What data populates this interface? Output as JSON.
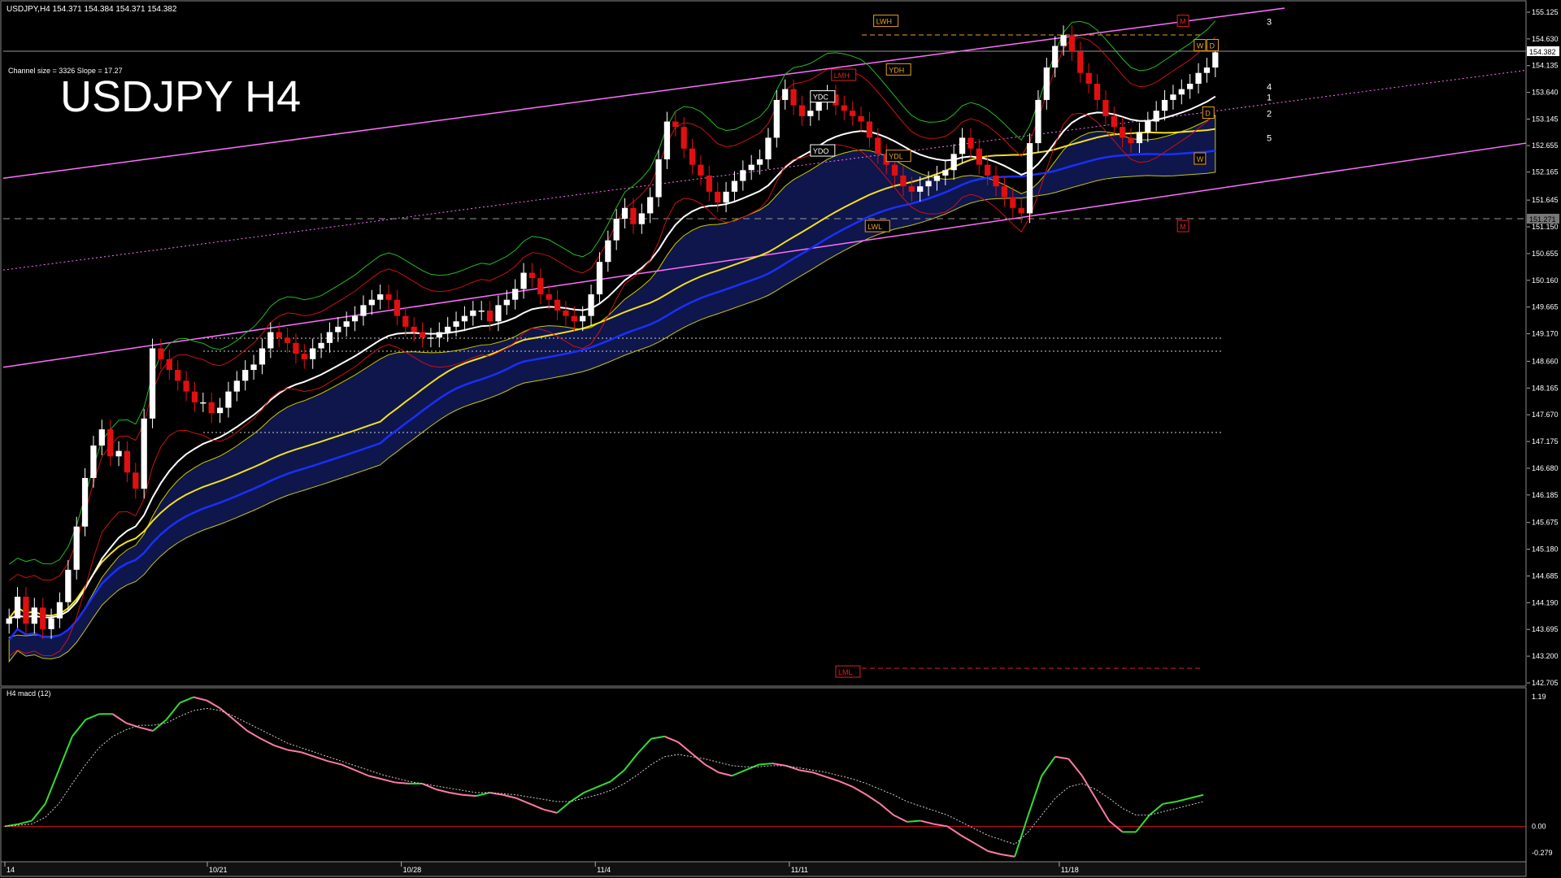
{
  "header": {
    "symbol_line": "USDJPY,H4  154.371 154.384 154.371 154.382",
    "channel_info": "Channel size = 3326 Slope = 17.27",
    "big_title": "USDJPY H4"
  },
  "macd_label": "H4  macd (12)",
  "current_price": "154.382",
  "h_line_price": "151.271",
  "colors": {
    "bg": "#000000",
    "grid": "#6e6e6e",
    "channel": "#ff6fff",
    "ema_white": "#ffffff",
    "ma_yellow": "#f2e01c",
    "ma_blue": "#1a2fff",
    "kumo": "#2a3ed8",
    "bull": "#ffffff",
    "bear": "#e01010",
    "macd_up": "#33dd33",
    "macd_down": "#ff7aa8",
    "signal": "#cccccc",
    "label_orange": "#e8a020",
    "label_red": "#e02020"
  },
  "chart_data": {
    "type": "line",
    "title": "USDJPY H4",
    "xlabel": "",
    "ylabel": "",
    "ylim": [
      142.705,
      155.2
    ],
    "grid": false,
    "y_ticks": [
      155.125,
      154.63,
      154.135,
      153.64,
      153.145,
      152.655,
      152.165,
      151.645,
      151.15,
      150.655,
      150.16,
      149.665,
      149.17,
      148.66,
      148.165,
      147.67,
      147.175,
      146.68,
      146.185,
      145.675,
      145.18,
      144.685,
      144.19,
      143.695,
      143.2,
      142.705
    ],
    "y_tick_labels": [
      "155.125",
      "154.630",
      "154.135",
      "153.640",
      "153.145",
      "152.655",
      "152.165",
      "151.645",
      "151.150",
      "150.655",
      "150.160",
      "149.665",
      "149.170",
      "148.660",
      "148.165",
      "147.670",
      "147.175",
      "146.680",
      "146.185",
      "145.675",
      "145.180",
      "144.685",
      "144.190",
      "143.695",
      "143.200",
      "142.705"
    ],
    "x_ticks": [
      {
        "i": 0,
        "label": "14"
      },
      {
        "i": 48,
        "label": "10/21"
      },
      {
        "i": 94,
        "label": "10/28"
      },
      {
        "i": 140,
        "label": "11/4"
      },
      {
        "i": 186,
        "label": "11/11"
      },
      {
        "i": 250,
        "label": "11/18"
      }
    ],
    "close": [
      143.9,
      144.3,
      143.8,
      144.1,
      143.7,
      143.9,
      144.2,
      144.8,
      145.6,
      146.5,
      147.1,
      147.4,
      146.9,
      147.0,
      146.6,
      146.3,
      147.6,
      148.9,
      148.7,
      148.5,
      148.3,
      148.1,
      147.9,
      147.9,
      147.7,
      147.8,
      148.1,
      148.3,
      148.5,
      148.6,
      148.9,
      149.2,
      149.1,
      149.0,
      148.8,
      148.7,
      148.9,
      149.0,
      149.2,
      149.3,
      149.4,
      149.5,
      149.7,
      149.8,
      149.9,
      149.8,
      149.5,
      149.3,
      149.2,
      149.1,
      149.1,
      149.2,
      149.3,
      149.4,
      149.5,
      149.6,
      149.6,
      149.4,
      149.7,
      149.8,
      150.0,
      150.3,
      150.2,
      149.9,
      149.8,
      149.6,
      149.5,
      149.4,
      149.5,
      149.9,
      150.5,
      150.9,
      151.3,
      151.5,
      151.2,
      151.4,
      151.7,
      152.4,
      153.1,
      153.0,
      152.6,
      152.3,
      152.1,
      151.8,
      151.6,
      151.8,
      152.0,
      152.2,
      152.3,
      152.4,
      152.8,
      153.5,
      153.7,
      153.4,
      153.2,
      153.3,
      153.5,
      153.6,
      153.4,
      153.3,
      153.2,
      153.1,
      152.8,
      152.5,
      152.3,
      152.1,
      151.9,
      151.8,
      151.9,
      152.0,
      152.1,
      152.2,
      152.5,
      152.8,
      152.6,
      152.3,
      152.1,
      151.9,
      151.7,
      151.5,
      151.4,
      152.7,
      153.5,
      154.1,
      154.5,
      154.7,
      154.4,
      154.0,
      153.8,
      153.5,
      153.2,
      153.0,
      152.8,
      152.7,
      152.9,
      153.1,
      153.3,
      153.5,
      153.6,
      153.7,
      153.8,
      154.0,
      154.1,
      154.382
    ],
    "series": [],
    "macd_ylim": [
      -0.279,
      1.19
    ],
    "macd_ticks": [
      "1.19",
      "0.00",
      "-0.279"
    ],
    "macd_main": [
      0.0,
      0.02,
      0.05,
      0.2,
      0.5,
      0.8,
      0.95,
      1.0,
      1.0,
      0.92,
      0.88,
      0.85,
      0.95,
      1.1,
      1.15,
      1.12,
      1.05,
      0.95,
      0.85,
      0.78,
      0.72,
      0.68,
      0.66,
      0.62,
      0.58,
      0.55,
      0.5,
      0.45,
      0.42,
      0.39,
      0.38,
      0.38,
      0.33,
      0.3,
      0.28,
      0.27,
      0.3,
      0.28,
      0.25,
      0.2,
      0.15,
      0.12,
      0.22,
      0.3,
      0.35,
      0.4,
      0.5,
      0.65,
      0.78,
      0.8,
      0.75,
      0.65,
      0.55,
      0.48,
      0.45,
      0.5,
      0.55,
      0.56,
      0.54,
      0.5,
      0.48,
      0.44,
      0.4,
      0.35,
      0.28,
      0.2,
      0.1,
      0.04,
      0.05,
      0.02,
      0.0,
      -0.08,
      -0.15,
      -0.22,
      -0.25,
      -0.27,
      0.1,
      0.45,
      0.62,
      0.6,
      0.45,
      0.25,
      0.05,
      -0.05,
      -0.05,
      0.1,
      0.2,
      0.22,
      0.25,
      0.28
    ],
    "macd_signal": [
      0.0,
      0.01,
      0.02,
      0.08,
      0.2,
      0.38,
      0.55,
      0.7,
      0.8,
      0.86,
      0.9,
      0.9,
      0.92,
      0.98,
      1.03,
      1.05,
      1.03,
      0.98,
      0.92,
      0.86,
      0.8,
      0.74,
      0.7,
      0.66,
      0.62,
      0.58,
      0.54,
      0.5,
      0.46,
      0.43,
      0.4,
      0.38,
      0.36,
      0.34,
      0.32,
      0.3,
      0.3,
      0.29,
      0.28,
      0.26,
      0.24,
      0.22,
      0.22,
      0.25,
      0.28,
      0.32,
      0.38,
      0.46,
      0.55,
      0.62,
      0.64,
      0.62,
      0.6,
      0.57,
      0.54,
      0.53,
      0.53,
      0.54,
      0.54,
      0.52,
      0.5,
      0.48,
      0.45,
      0.42,
      0.38,
      0.33,
      0.28,
      0.22,
      0.18,
      0.14,
      0.1,
      0.04,
      -0.02,
      -0.08,
      -0.12,
      -0.16,
      -0.05,
      0.1,
      0.25,
      0.35,
      0.38,
      0.33,
      0.25,
      0.16,
      0.1,
      0.1,
      0.13,
      0.16,
      0.19,
      0.22
    ],
    "annotations": [
      {
        "text": "LWH",
        "i": 205,
        "price": 154.95,
        "color": "#e8a020"
      },
      {
        "text": "LMH",
        "i": 195,
        "price": 153.95,
        "color": "#e02020"
      },
      {
        "text": "YDH",
        "i": 208,
        "price": 154.05,
        "color": "#e8a020"
      },
      {
        "text": "YDC",
        "i": 190,
        "price": 153.55,
        "color": "#ffffff"
      },
      {
        "text": "YDO",
        "i": 190,
        "price": 152.55,
        "color": "#ffffff"
      },
      {
        "text": "YDL",
        "i": 208,
        "price": 152.45,
        "color": "#e8a020"
      },
      {
        "text": "LWL",
        "i": 203,
        "price": 151.15,
        "color": "#e8a020"
      },
      {
        "text": "LML",
        "i": 196,
        "price": 142.9,
        "color": "#e02020"
      },
      {
        "text": "M",
        "i": 277,
        "price": 154.95,
        "color": "#e02020"
      },
      {
        "text": "M",
        "i": 277,
        "price": 151.15,
        "color": "#e02020"
      },
      {
        "text": "W",
        "i": 281,
        "price": 154.5,
        "color": "#e8a020"
      },
      {
        "text": "D",
        "i": 284,
        "price": 154.5,
        "color": "#e8a020"
      },
      {
        "text": "D",
        "i": 283,
        "price": 153.25,
        "color": "#e8a020"
      },
      {
        "text": "W",
        "i": 281,
        "price": 152.4,
        "color": "#e8a020"
      }
    ],
    "fib_labels": [
      {
        "text": "3",
        "price": 154.95
      },
      {
        "text": "4",
        "price": 153.75
      },
      {
        "text": "1",
        "price": 153.55
      },
      {
        "text": "2",
        "price": 153.25
      },
      {
        "text": "5",
        "price": 152.8
      }
    ]
  }
}
